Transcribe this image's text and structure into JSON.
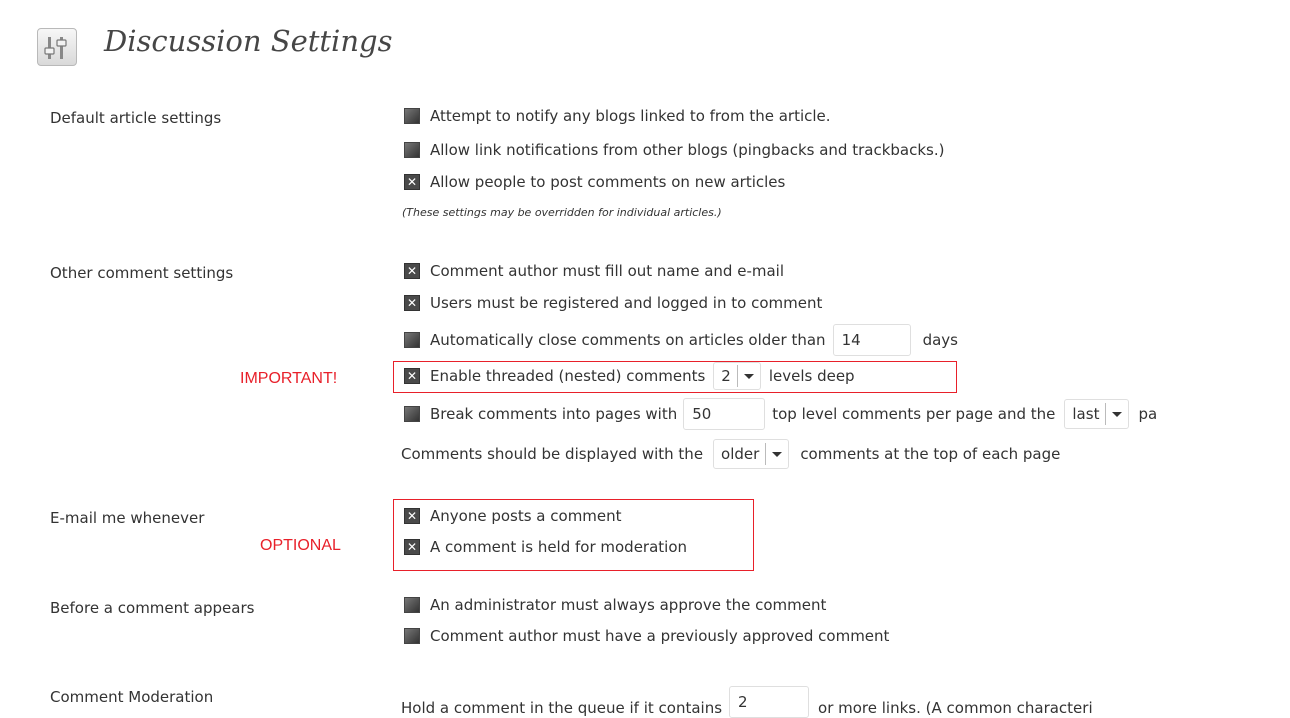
{
  "page": {
    "title": "Discussion Settings",
    "icon": "settings-sliders-icon"
  },
  "sections": {
    "default_article": {
      "label": "Default article settings",
      "options": [
        {
          "label": "Attempt to notify any blogs linked to from the article.",
          "checked": false
        },
        {
          "label": "Allow link notifications from other blogs (pingbacks and trackbacks.)",
          "checked": false
        },
        {
          "label": "Allow people to post comments on new articles",
          "checked": true
        }
      ],
      "note": "(These settings may be overridden for individual articles.)"
    },
    "other_comment": {
      "label": "Other comment settings",
      "fill_name_email": {
        "label": "Comment author must fill out name and e-mail",
        "checked": true
      },
      "registered_only": {
        "label": "Users must be registered and logged in to comment",
        "checked": true
      },
      "auto_close": {
        "label_before": "Automatically close comments on articles older than",
        "value": "14",
        "label_after": "days",
        "checked": false
      },
      "threaded": {
        "label_before": "Enable threaded (nested) comments",
        "value": "2",
        "label_after": "levels deep",
        "checked": true
      },
      "paged": {
        "label_before": "Break comments into pages with",
        "value": "50",
        "label_middle": "top level comments per page and the",
        "select_value": "last",
        "label_after": "pa",
        "checked": false
      },
      "order": {
        "label_before": "Comments should be displayed with the",
        "select_value": "older",
        "label_after": "comments at the top of each page"
      }
    },
    "email_me": {
      "label": "E-mail me whenever",
      "options": [
        {
          "label": "Anyone posts a comment",
          "checked": true
        },
        {
          "label": "A comment is held for moderation",
          "checked": true
        }
      ]
    },
    "before_appears": {
      "label": "Before a comment appears",
      "options": [
        {
          "label": "An administrator must always approve the comment",
          "checked": false
        },
        {
          "label": "Comment author must have a previously approved comment",
          "checked": false
        }
      ]
    },
    "moderation": {
      "label": "Comment Moderation",
      "label_before": "Hold a comment in the queue if it contains",
      "value": "2",
      "label_after": "or more links. (A common characteri"
    }
  },
  "annotations": {
    "important": "IMPORTANT!",
    "optional": "OPTIONAL",
    "color": "#e8202a"
  }
}
